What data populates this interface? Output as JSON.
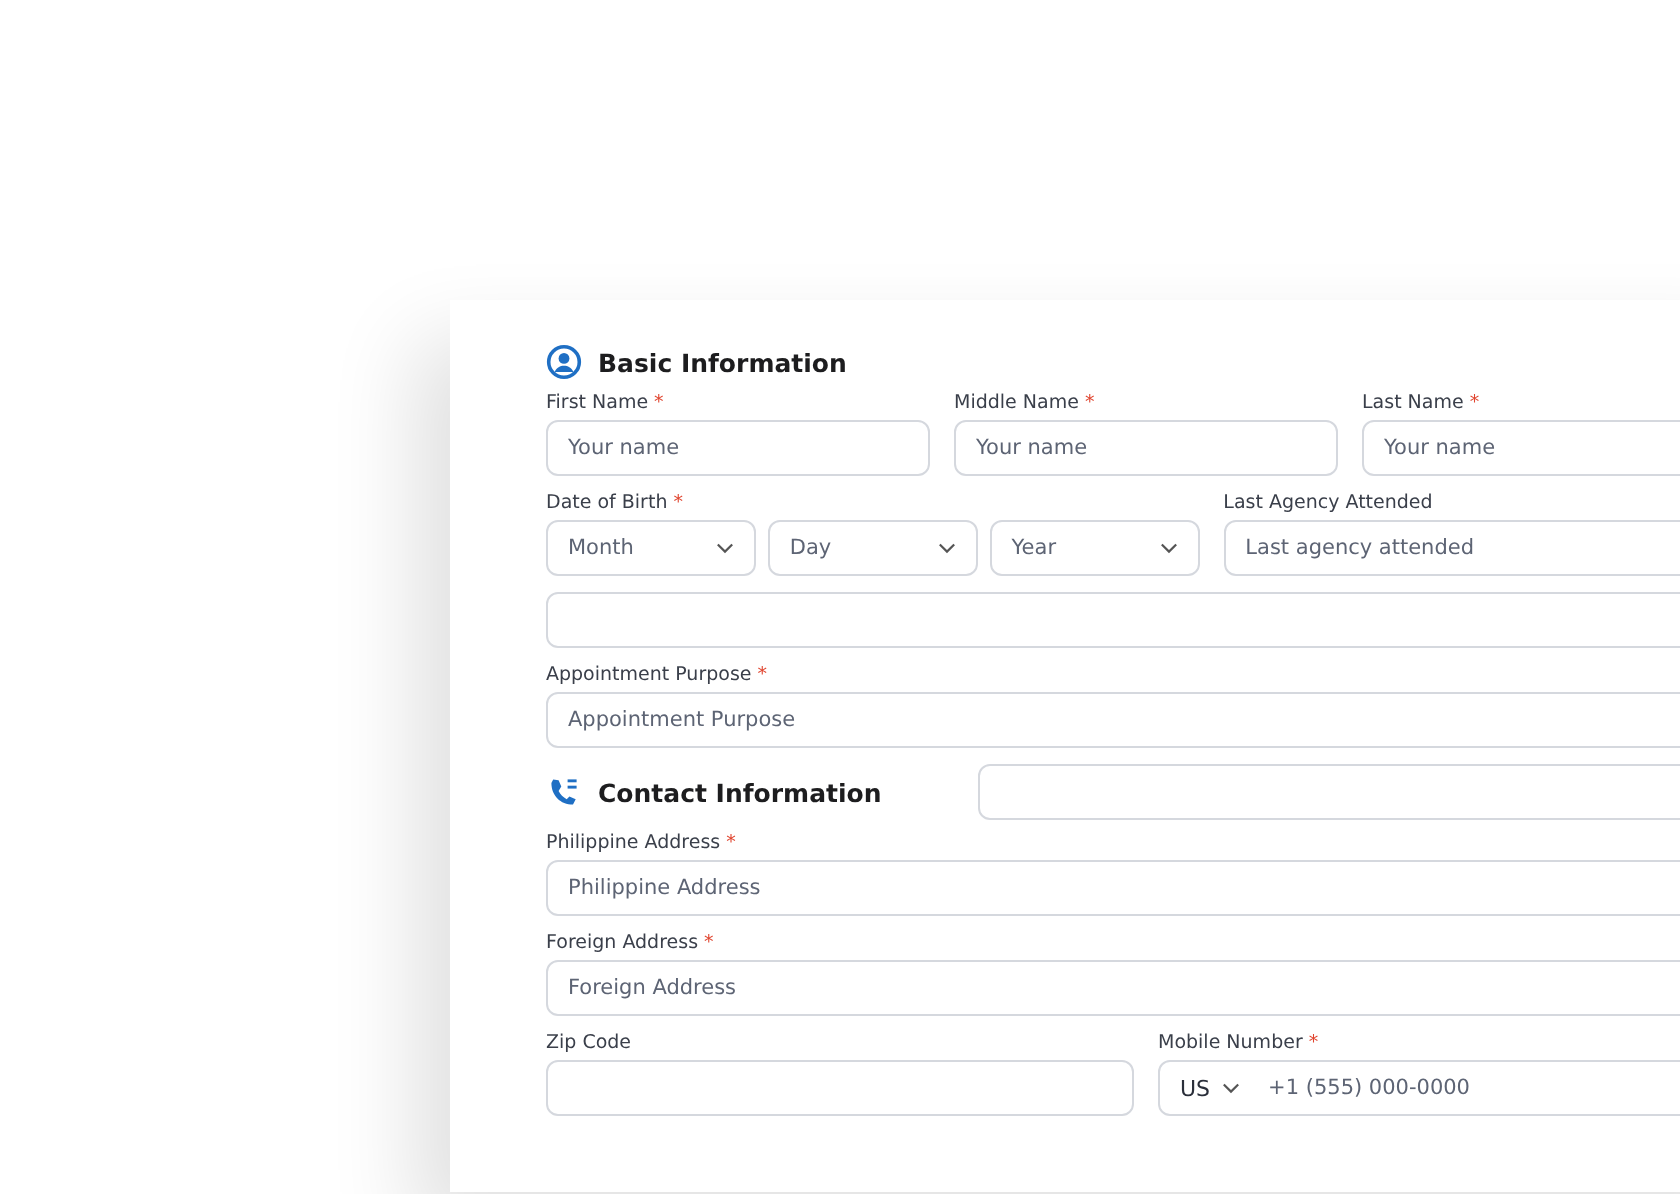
{
  "sections": [
    {
      "title": "Basic Information",
      "rows": [
        {
          "fields": [
            {
              "kind": "text",
              "label": "First Name",
              "required_mark": "*",
              "placeholder": "Your name"
            },
            {
              "kind": "text",
              "label": "Middle Name",
              "required_mark": "*",
              "placeholder": "Your name"
            },
            {
              "kind": "text",
              "label": "Last Name",
              "required_mark": "*",
              "placeholder": "Your name"
            }
          ]
        },
        {
          "fields": [
            {
              "kind": "date",
              "label": "Date of Birth",
              "required_mark": "*",
              "parts": [
                "Month",
                "Day",
                "Year"
              ]
            },
            {
              "kind": "text",
              "label": "Last Agency Attended",
              "placeholder": "Last agency attended"
            }
          ]
        },
        {
          "fields": [
            {
              "kind": "select"
            }
          ]
        },
        {
          "fields": [
            {
              "kind": "text",
              "label": "Appointment Purpose",
              "required_mark": "*",
              "placeholder": "Appointment Purpose"
            }
          ]
        }
      ]
    },
    {
      "title": "Contact Information",
      "rows": [
        {
          "fields": [
            {
              "kind": "text",
              "label": "Philippine Address",
              "required_mark": "*",
              "placeholder": "Philippine Address"
            }
          ]
        },
        {
          "fields": [
            {
              "kind": "text",
              "label": "Foreign Address",
              "required_mark": "*",
              "placeholder": "Foreign Address"
            }
          ]
        },
        {
          "fields": [
            {
              "kind": "text",
              "label": "Zip Code"
            },
            {
              "kind": "phone",
              "label": "Mobile Number",
              "required_mark": "*",
              "country": "US",
              "placeholder": "+1 (555) 000-0000"
            }
          ]
        }
      ]
    }
  ]
}
